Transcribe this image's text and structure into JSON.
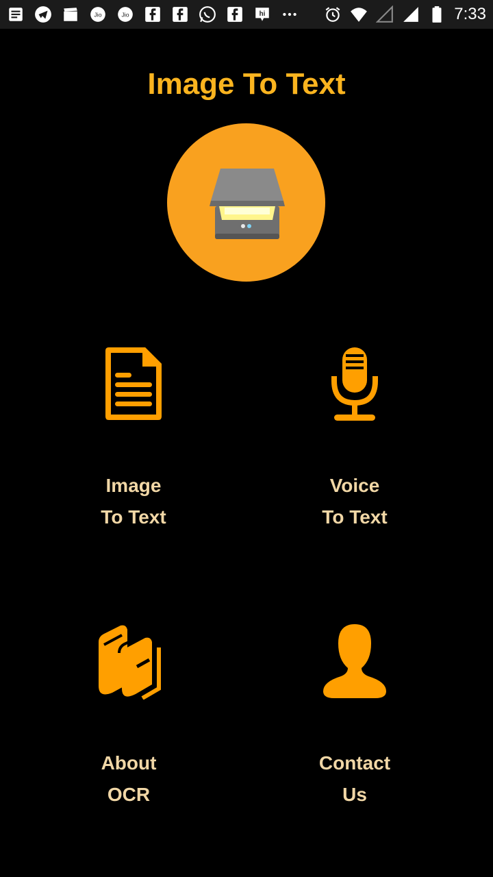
{
  "status_bar": {
    "time": "7:33",
    "left_icons": [
      "news-icon",
      "telegram-icon",
      "clapper-icon",
      "jio-icon",
      "jio-icon",
      "facebook-icon",
      "facebook-icon",
      "whatsapp-icon",
      "facebook-icon",
      "hike-icon",
      "more-dots-icon"
    ],
    "right_icons": [
      "alarm-icon",
      "wifi-icon",
      "signal-empty-icon",
      "signal-icon",
      "battery-icon"
    ]
  },
  "app": {
    "title": "Image To Text"
  },
  "menu": [
    {
      "id": "image",
      "line1": "Image",
      "line2": "To Text",
      "icon": "document-icon"
    },
    {
      "id": "voice",
      "line1": "Voice",
      "line2": "To Text",
      "icon": "microphone-icon"
    },
    {
      "id": "about",
      "line1": "About",
      "line2": "OCR",
      "icon": "books-icon"
    },
    {
      "id": "contact",
      "line1": "Contact",
      "line2": "Us",
      "icon": "person-icon"
    }
  ],
  "colors": {
    "accent": "#fbb41f",
    "icon": "#ff9f00",
    "label": "#f1d7a6",
    "background": "#000000"
  }
}
